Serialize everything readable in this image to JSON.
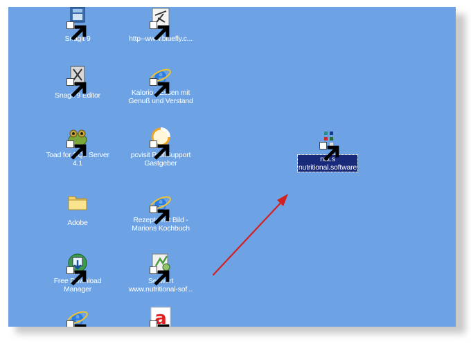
{
  "desktop": {
    "icons": [
      {
        "name": "snagit-9-icon",
        "lines": [
          "Snagit 9"
        ]
      },
      {
        "name": "bluefly-url-icon",
        "lines": [
          "http--www.bluefly.c..."
        ]
      },
      {
        "name": "snagit-9-editor-icon",
        "lines": [
          "Snagit 9 Editor"
        ]
      },
      {
        "name": "kalorio-icon",
        "lines": [
          "Kalorio - Essen mit",
          "Genuß und Verstand"
        ]
      },
      {
        "name": "toad-sql-server-icon",
        "lines": [
          "Toad for SQL Server",
          "4.1"
        ]
      },
      {
        "name": "pcvisit-icon",
        "lines": [
          "pcvisit ProfiSupport",
          "Gastgeber"
        ]
      },
      {
        "name": "adobe-folder-icon",
        "lines": [
          "Adobe"
        ]
      },
      {
        "name": "rezepte-icon",
        "lines": [
          "Rezepte mit Bild -",
          "Marions Kochbuch"
        ]
      },
      {
        "name": "free-download-manager-icon",
        "lines": [
          "Free Download",
          "Manager"
        ]
      },
      {
        "name": "seitwert-icon",
        "lines": [
          "Seitwert",
          "www.nutritional-sof..."
        ]
      },
      {
        "name": "ie-shortcut-icon",
        "lines": [
          ""
        ]
      },
      {
        "name": "red-a-shortcut-icon",
        "lines": [
          ""
        ]
      }
    ],
    "selected_icon": {
      "lines": [
        "nut.s",
        "nutritional.software"
      ]
    },
    "accent": {
      "desktop_bg": "#6da3e4",
      "selection_bg": "#1a2a7a",
      "arrow": "#d42020"
    }
  }
}
